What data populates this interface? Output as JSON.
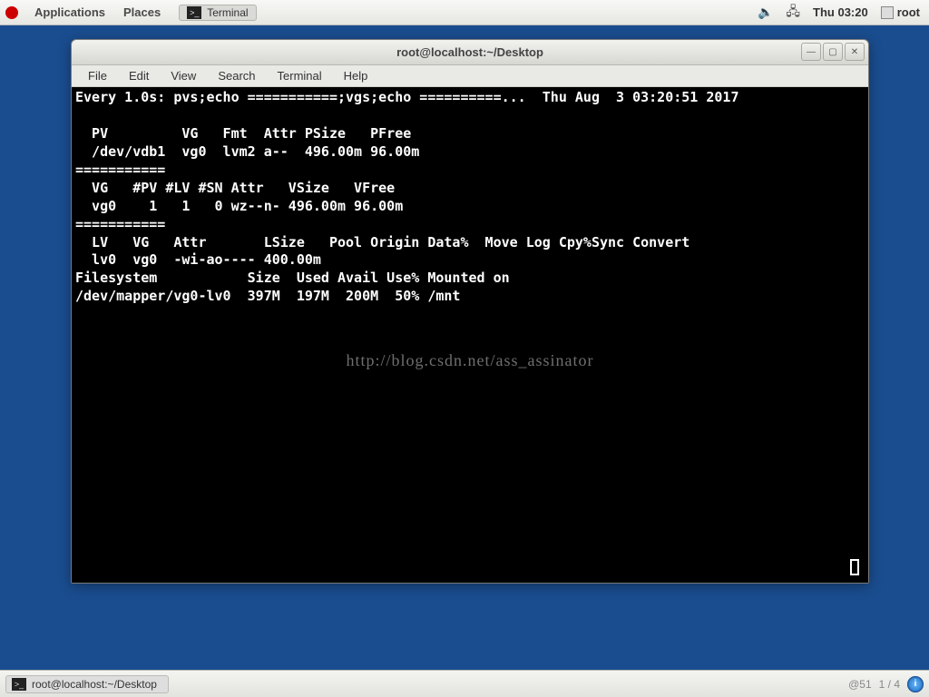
{
  "top_panel": {
    "menus": {
      "applications": "Applications",
      "places": "Places"
    },
    "task": "Terminal",
    "clock": "Thu 03:20",
    "user": "root"
  },
  "window": {
    "title": "root@localhost:~/Desktop",
    "menubar": {
      "file": "File",
      "edit": "Edit",
      "view": "View",
      "search": "Search",
      "terminal": "Terminal",
      "help": "Help"
    },
    "terminal_lines": [
      "Every 1.0s: pvs;echo ===========;vgs;echo ==========...  Thu Aug  3 03:20:51 2017",
      "",
      "  PV         VG   Fmt  Attr PSize   PFree ",
      "  /dev/vdb1  vg0  lvm2 a--  496.00m 96.00m",
      "===========",
      "  VG   #PV #LV #SN Attr   VSize   VFree ",
      "  vg0    1   1   0 wz--n- 496.00m 96.00m",
      "===========",
      "  LV   VG   Attr       LSize   Pool Origin Data%  Move Log Cpy%Sync Convert",
      "  lv0  vg0  -wi-ao---- 400.00m",
      "Filesystem           Size  Used Avail Use% Mounted on",
      "/dev/mapper/vg0-lv0  397M  197M  200M  50% /mnt"
    ],
    "watermark": "http://blog.csdn.net/ass_assinator"
  },
  "bottom_panel": {
    "task": "root@localhost:~/Desktop",
    "counter": "1 / 4",
    "annotation": "@51"
  }
}
